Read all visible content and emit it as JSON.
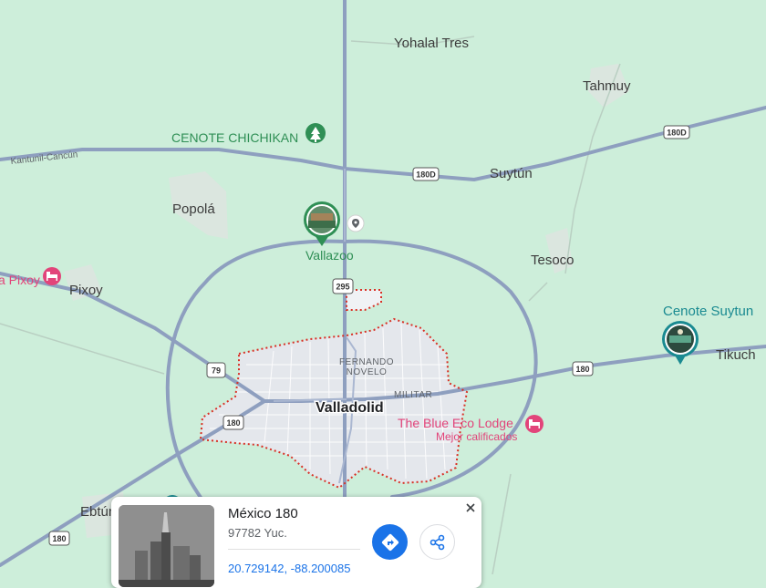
{
  "map": {
    "places": {
      "yohalal_tres": "Yohalal Tres",
      "tahmuy": "Tahmuy",
      "cenote_chichikan": "CENOTE CHICHIKAN",
      "kantunil_cancun": "Kantunil-Cancún",
      "suytun": "Suytún",
      "popola": "Popolá",
      "vallazoo": "Vallazoo",
      "tesoco": "Tesoco",
      "pixoy_poi": "a Pixoy",
      "pixoy": "Pixoy",
      "cenote_suytun": "Cenote Suytun",
      "tikuch": "Tikuch",
      "fernando": "FERNANDO",
      "novelo": "NOVELO",
      "militar": "MILITAR",
      "valladolid": "Valladolid",
      "blue_eco_lodge": "The Blue Eco Lodge",
      "mejor_calificados": "Mejor calificados",
      "ebtun": "Ebtún"
    },
    "shields": {
      "s180d_a": "180D",
      "s180d_b": "180D",
      "s295": "295",
      "s79": "79",
      "s180_a": "180",
      "s180_b": "180",
      "s180_c": "180"
    },
    "colors": {
      "land": "#cdeeda",
      "road": "#8e9fbf",
      "boundary": "#d93025",
      "accent": "#1a73e8"
    }
  },
  "card": {
    "title": "México 180",
    "subtitle": "97782 Yuc.",
    "coordinates": "20.729142, -88.200085",
    "directions_icon": "directions-icon",
    "share_icon": "share-icon",
    "close_icon": "close-icon"
  }
}
